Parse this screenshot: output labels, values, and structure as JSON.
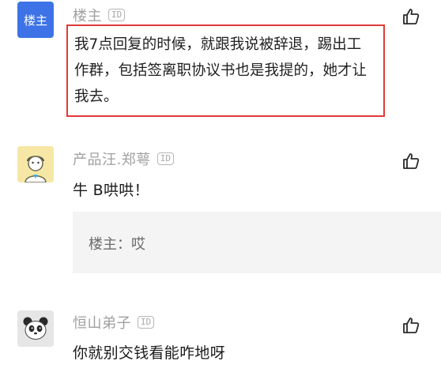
{
  "comments": [
    {
      "avatar_label": "楼主",
      "username": "楼主",
      "id_badge": "ID",
      "text": "我7点回复的时候，就跟我说被辞退，踢出工作群，包括签离职协议书也是我提的，她才让我去。"
    },
    {
      "username": "产品汪.郑萼",
      "id_badge": "ID",
      "text": "牛 B哄哄！",
      "reply": {
        "author": "楼主",
        "separator": "：",
        "text": "哎"
      }
    },
    {
      "username": "恒山弟子",
      "id_badge": "ID",
      "text": "你就别交钱看能咋地呀"
    }
  ],
  "icons": {
    "like": "thumbs-up-icon"
  },
  "colors": {
    "highlight": "#e03a3a",
    "avatar_blue": "#3d73e6"
  }
}
